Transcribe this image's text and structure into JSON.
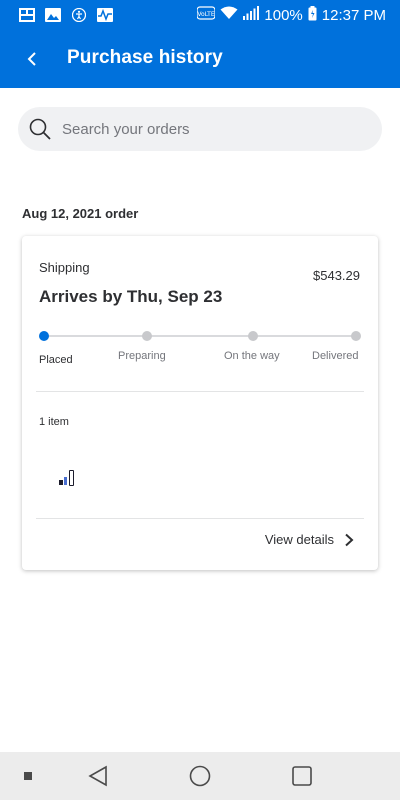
{
  "status_bar": {
    "battery": "100%",
    "time": "12:37 PM",
    "icons": [
      "app-icon",
      "image-icon",
      "accessibility-icon",
      "activity-icon",
      "volte-icon",
      "wifi-icon",
      "signal-icon",
      "battery-icon"
    ]
  },
  "header": {
    "title": "Purchase history",
    "back_icon": "chevron-left-icon"
  },
  "search": {
    "placeholder": "Search your orders",
    "icon": "search-icon"
  },
  "order": {
    "date_label": "Aug 12, 2021 order",
    "shipping_label": "Shipping",
    "price": "$543.29",
    "arrival": "Arrives by Thu, Sep 23",
    "progress": {
      "steps": [
        "Placed",
        "Preparing",
        "On the way",
        "Delivered"
      ],
      "current_step_index": 0
    },
    "items_count": "1 item",
    "view_details_label": "View details"
  },
  "colors": {
    "brand": "#0071dc",
    "text": "#2e2f32",
    "muted": "#74767c"
  },
  "nav_bar": {
    "icons": [
      "recent-apps-icon",
      "back-triangle-icon",
      "home-circle-icon",
      "overview-square-icon"
    ]
  }
}
